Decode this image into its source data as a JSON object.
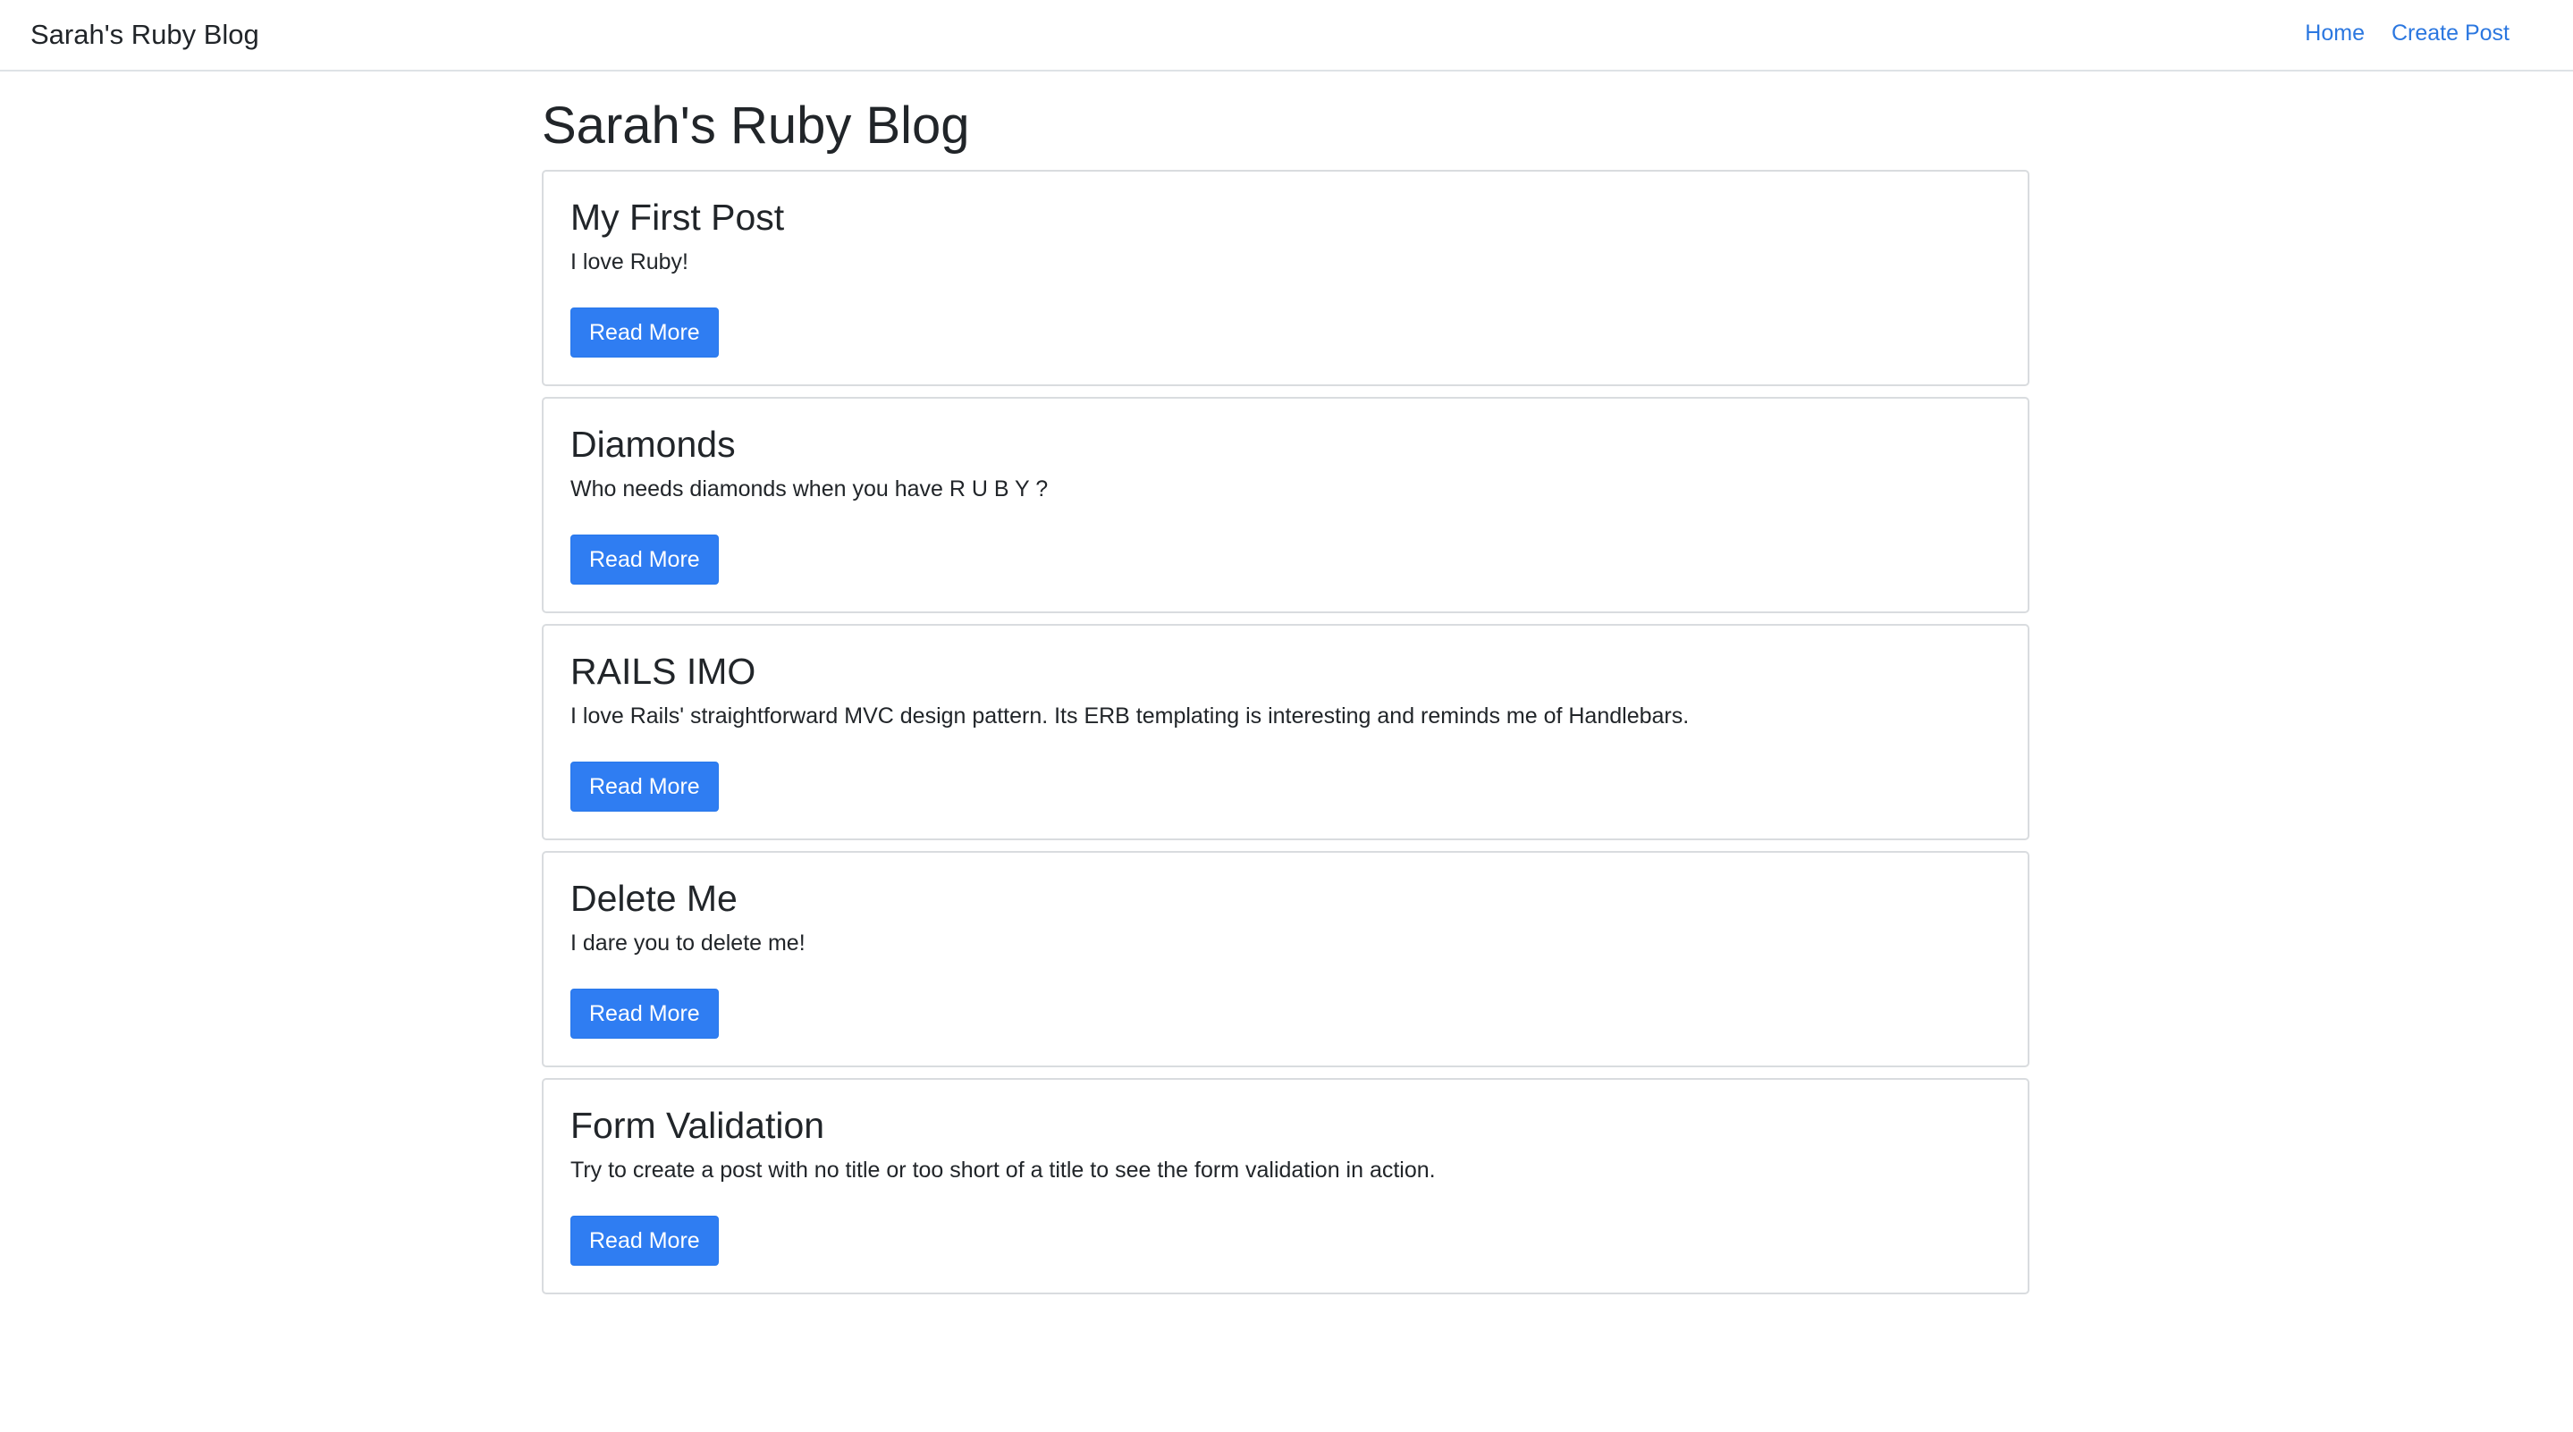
{
  "navbar": {
    "brand": "Sarah's Ruby Blog",
    "links": [
      "Home",
      "Create Post"
    ]
  },
  "main": {
    "title": "Sarah's Ruby Blog",
    "posts": [
      {
        "title": "My First Post",
        "body": "I love Ruby!",
        "button": "Read More"
      },
      {
        "title": "Diamonds",
        "body": "Who needs diamonds when you have R U B Y ?",
        "button": "Read More"
      },
      {
        "title": "RAILS IMO",
        "body": "I love Rails' straightforward MVC design pattern. Its ERB templating is interesting and reminds me of Handlebars.",
        "button": "Read More"
      },
      {
        "title": "Delete Me",
        "body": "I dare you to delete me!",
        "button": "Read More"
      },
      {
        "title": "Form Validation",
        "body": "Try to create a post with no title or too short of a title to see the form validation in action.",
        "button": "Read More"
      }
    ]
  },
  "colors": {
    "accent": "#2f7df2",
    "link": "#2b77e0",
    "text": "#212529",
    "border": "#d9dcdf"
  }
}
